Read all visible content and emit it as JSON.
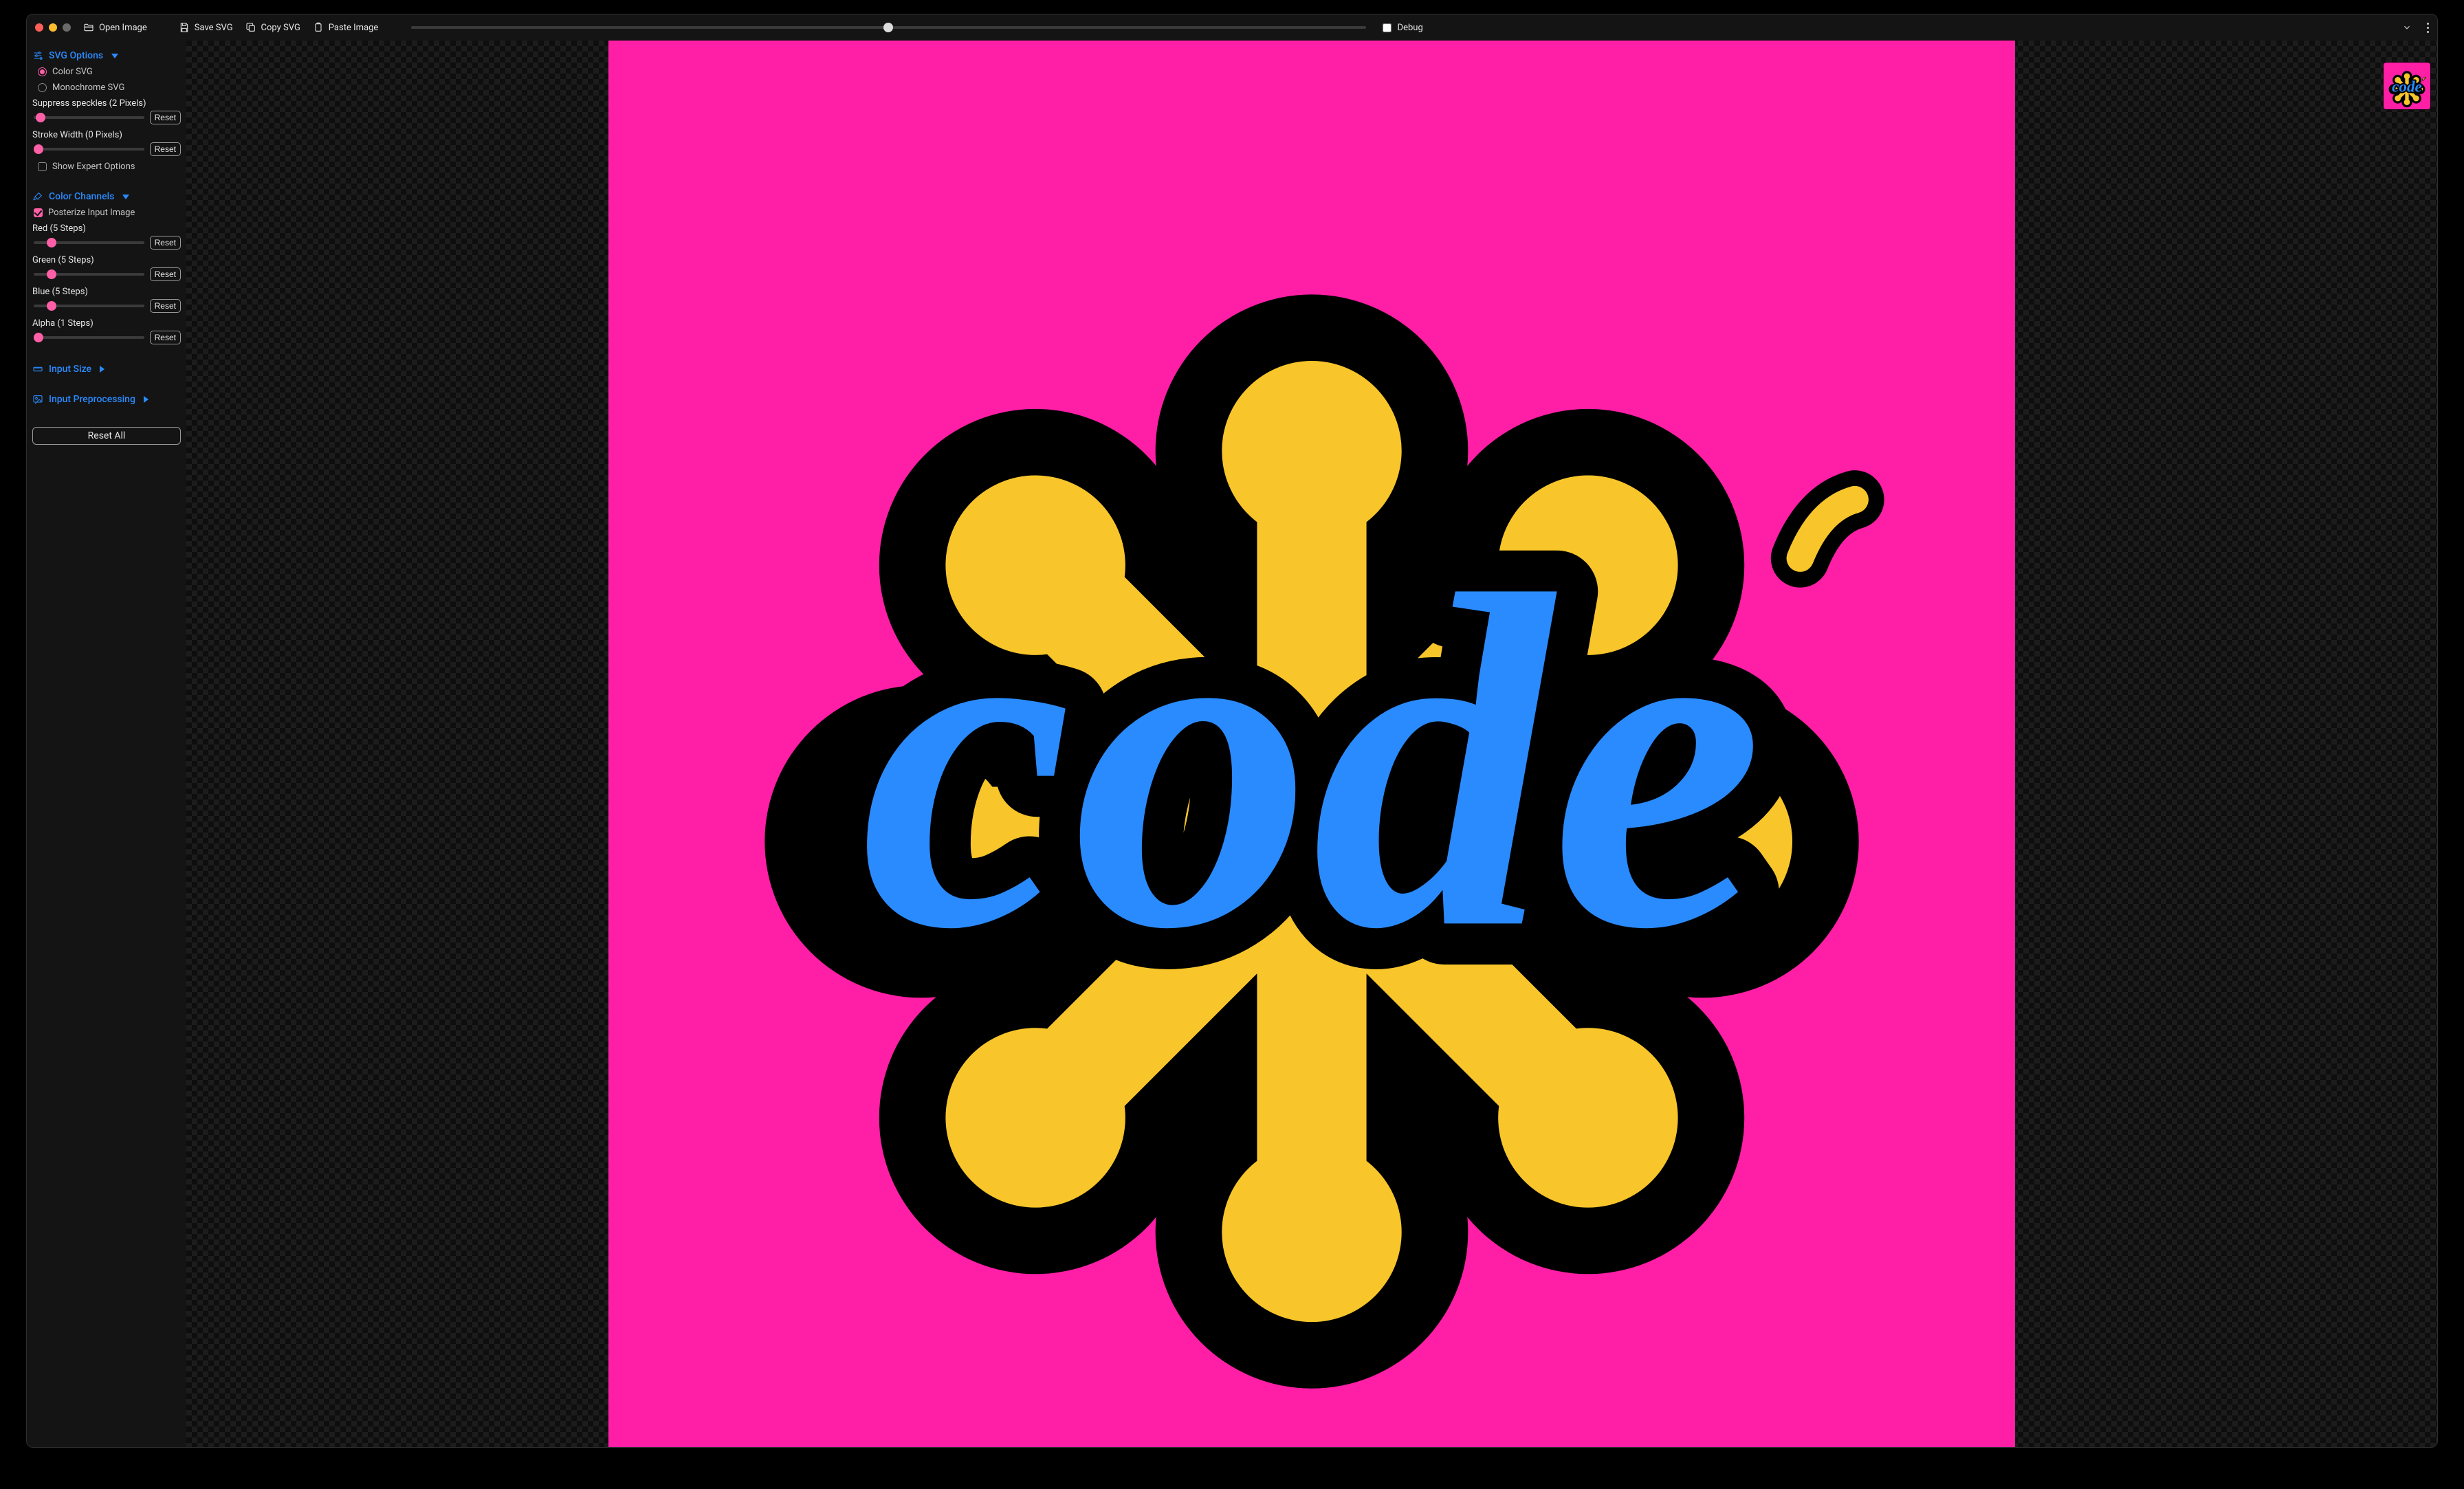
{
  "toolbar": {
    "open_image": "Open Image",
    "save_svg": "Save SVG",
    "copy_svg": "Copy SVG",
    "paste_image": "Paste Image",
    "debug_label": "Debug",
    "debug_checked": false,
    "zoom_value": 50
  },
  "sections": {
    "svg_options": {
      "title": "SVG Options",
      "expanded": true,
      "mode_options": [
        {
          "label": "Color SVG",
          "selected": true
        },
        {
          "label": "Monochrome SVG",
          "selected": false
        }
      ],
      "suppress_speckles": {
        "label": "Suppress speckles (2 Pixels)",
        "value": 2,
        "min": 0,
        "max": 100
      },
      "stroke_width": {
        "label": "Stroke Width (0 Pixels)",
        "value": 0,
        "min": 0,
        "max": 50
      },
      "show_expert": {
        "label": "Show Expert Options",
        "checked": false
      },
      "reset_label": "Reset"
    },
    "color_channels": {
      "title": "Color Channels",
      "expanded": true,
      "posterize": {
        "label": "Posterize Input Image",
        "checked": true
      },
      "red": {
        "label": "Red (5 Steps)",
        "value": 5,
        "min": 1,
        "max": 32
      },
      "green": {
        "label": "Green (5 Steps)",
        "value": 5,
        "min": 1,
        "max": 32
      },
      "blue": {
        "label": "Blue (5 Steps)",
        "value": 5,
        "min": 1,
        "max": 32
      },
      "alpha": {
        "label": "Alpha (1 Steps)",
        "value": 1,
        "min": 1,
        "max": 32
      },
      "reset_label": "Reset"
    },
    "input_size": {
      "title": "Input Size",
      "expanded": false
    },
    "input_preprocessing": {
      "title": "Input Preprocessing",
      "expanded": false
    }
  },
  "reset_all_label": "Reset All",
  "artwork": {
    "background": "#ff1ea6",
    "outline": "#000000",
    "starburst": "#f8c62a",
    "text_color": "#2a8bff",
    "text": "code"
  }
}
